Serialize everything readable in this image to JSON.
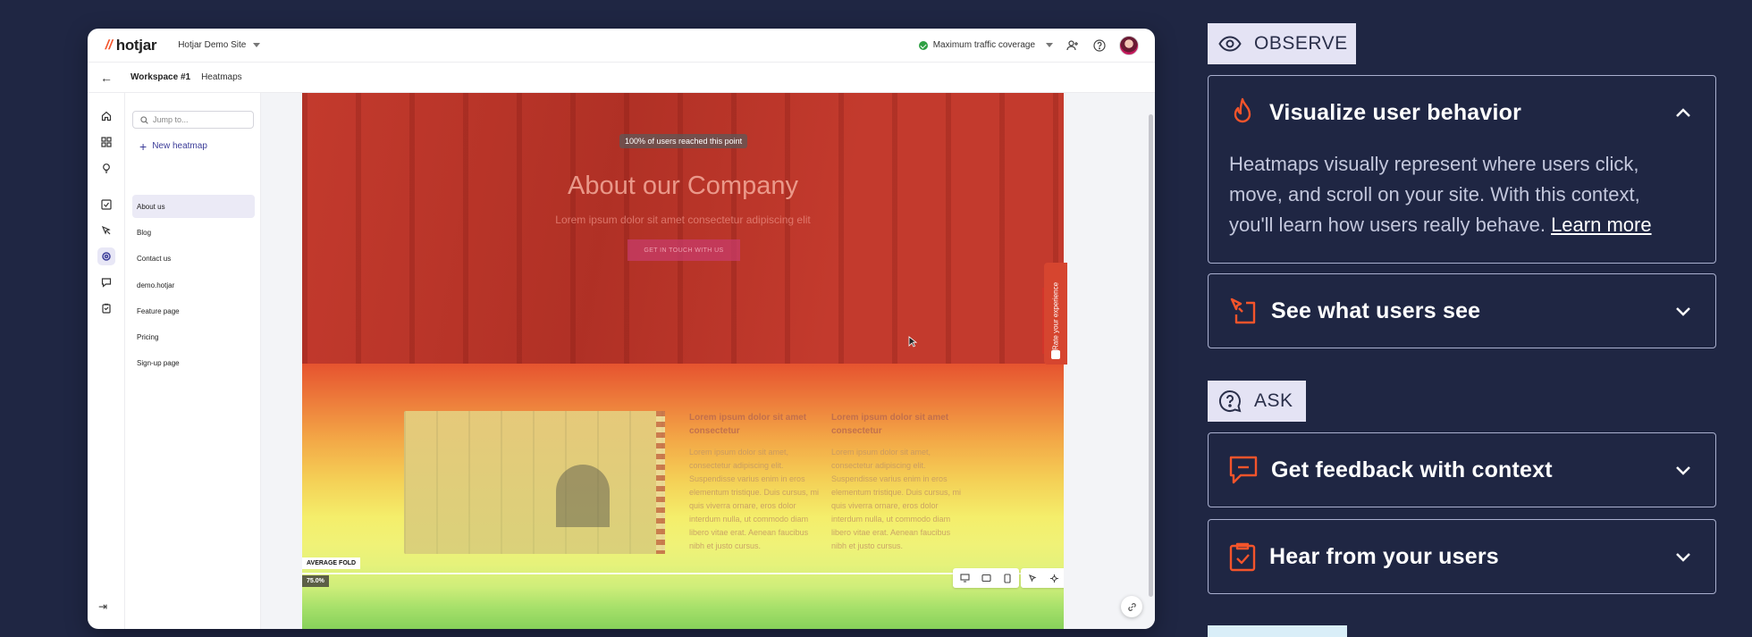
{
  "app": {
    "logo_text": "hotjar",
    "site_name": "Hotjar Demo Site",
    "traffic_label": "Maximum traffic coverage",
    "breadcrumb": {
      "workspace": "Workspace #1",
      "section": "Heatmaps"
    },
    "search_placeholder": "Jump to...",
    "new_heatmap_label": "New heatmap",
    "pages": [
      "About us",
      "Blog",
      "Contact us",
      "demo.hotjar",
      "Feature page",
      "Pricing",
      "Sign-up page"
    ],
    "active_page": "About us",
    "rail_icons": [
      "home-icon",
      "dashboard-icon",
      "lightbulb-icon",
      "checklist-icon",
      "recordings-icon",
      "heatmaps-icon",
      "feedback-icon",
      "survey-icon"
    ],
    "rate_tab_label": "Rate your experience"
  },
  "heatmap": {
    "reach_label": "100% of users reached this point",
    "hero_title": "About our Company",
    "hero_sub": "Lorem ipsum dolor sit amet consectetur adipiscing elit",
    "hero_button": "GET IN TOUCH WITH US",
    "col1_title": "Lorem ipsum dolor sit amet consectetur",
    "col1_text": "Lorem ipsum dolor sit amet, consectetur adipiscing elit. Suspendisse varius enim in eros elementum tristique. Duis cursus, mi quis viverra ornare, eros dolor interdum nulla, ut commodo diam libero vitae erat. Aenean faucibus nibh et justo cursus.",
    "col2_title": "Lorem ipsum dolor sit amet consectetur",
    "col2_text": "Lorem ipsum dolor sit amet, consectetur adipiscing elit. Suspendisse varius enim in eros elementum tristique. Duis cursus, mi quis viverra ornare, eros dolor interdum nulla, ut commodo diam libero vitae erat. Aenean faucibus nibh et justo cursus.",
    "fold_label": "AVERAGE FOLD",
    "fold_percent": "75.0%"
  },
  "panel": {
    "observe_tag": "OBSERVE",
    "ask_tag": "ASK",
    "accent_color": "#f4542b",
    "cards": [
      {
        "title": "Visualize user behavior",
        "expanded": true,
        "icon": "fire-icon",
        "body": "Heatmaps visually represent where users click, move, and scroll on your site. With this context, you'll learn how users really behave.",
        "link": "Learn more"
      },
      {
        "title": "See what users see",
        "expanded": false,
        "icon": "recording-icon"
      },
      {
        "title": "Get feedback with context",
        "expanded": false,
        "icon": "feedback-icon"
      },
      {
        "title": "Hear from your users",
        "expanded": false,
        "icon": "clipboard-check-icon"
      }
    ]
  }
}
